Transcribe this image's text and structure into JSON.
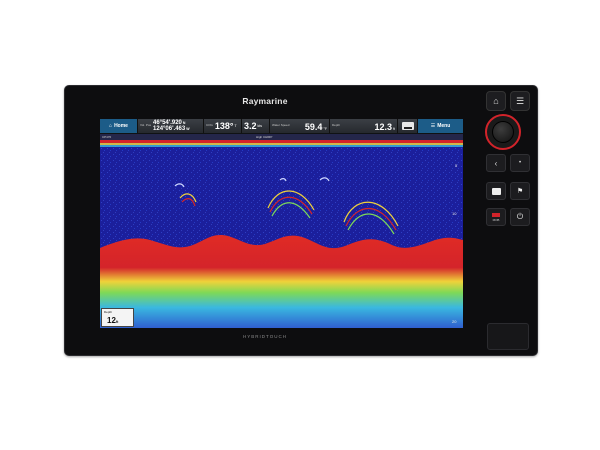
{
  "device": {
    "brand": "Raymarine",
    "footer_brand": "HYBRIDTOUCH"
  },
  "databar": {
    "home_label": "Home",
    "position": {
      "label": "Vsl. Pos",
      "lat": "46°54'.920",
      "lat_hemi": "N",
      "lon": "124°06'.463",
      "lon_hemi": "W"
    },
    "cog": {
      "label": "COG",
      "value": "138°",
      "unit": "T"
    },
    "sog": {
      "label": "SOG",
      "value": "3.2",
      "unit": "kts"
    },
    "water_speed": {
      "label": "Water Speed",
      "value": "59.4",
      "unit": "°F"
    },
    "depth": {
      "label": "Depth",
      "value": "12.3",
      "unit": "ft"
    },
    "menu_label": "Menu"
  },
  "sonar": {
    "channel_left": "CP470",
    "channel_center": "High CHIRP",
    "scale_labels": [
      "5",
      "10",
      "20"
    ],
    "depth_box": {
      "label": "Depth",
      "value": "12",
      "unit": "ft"
    },
    "colors": {
      "water": "#1b1f9c",
      "bottom_red": "#d4242a",
      "bottom_yellow": "#f0d23a",
      "bottom_cyan": "#3ab8e0"
    }
  },
  "controls": {
    "home_icon": "home-icon",
    "menu_icon": "hamburger-menu-icon",
    "back_icon": "chevron-left-icon",
    "waypoint_label": "",
    "man_overboard_label": "MOB",
    "power_label": ""
  }
}
